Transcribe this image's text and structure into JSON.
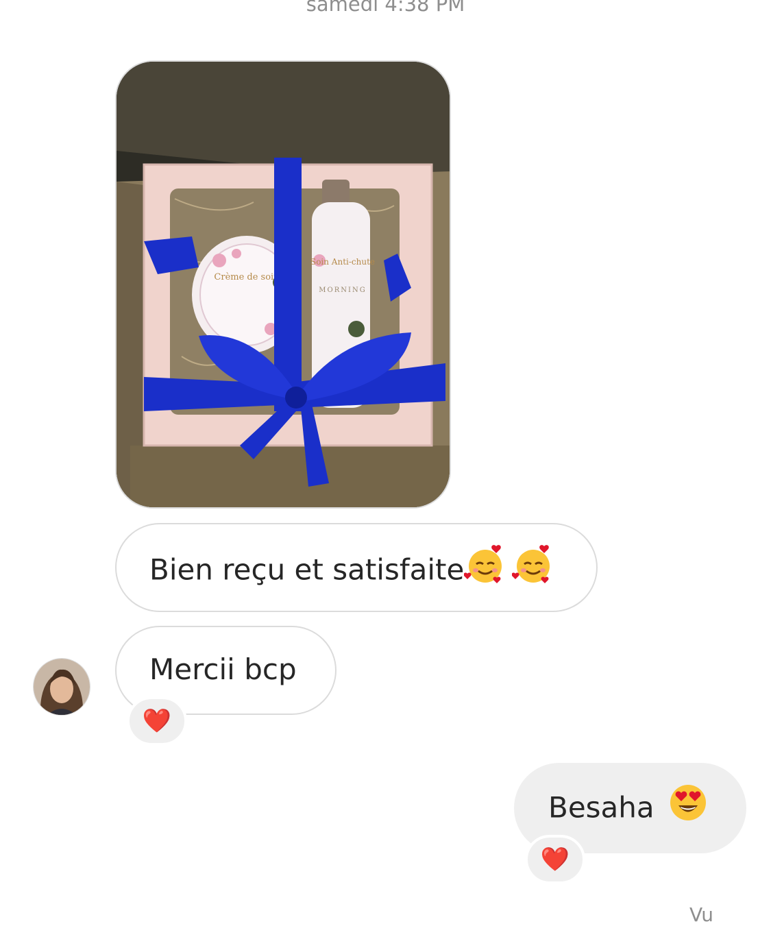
{
  "conversation": {
    "timestamp": "samedi 4:38 PM",
    "seen_label": "Vu"
  },
  "messages": [
    {
      "id": "m0",
      "type": "image",
      "sender": "contact"
    },
    {
      "id": "m1",
      "type": "text",
      "sender": "contact",
      "text": "Bien reçu et satisfaite",
      "emojis": [
        "smiling-face-with-hearts",
        "smiling-face-with-hearts"
      ]
    },
    {
      "id": "m2",
      "type": "text",
      "sender": "contact",
      "text": "Mercii bcp",
      "reaction": "❤️"
    },
    {
      "id": "m3",
      "type": "text",
      "sender": "me",
      "text": "Besaha",
      "emojis": [
        "heart-eyes"
      ],
      "reaction": "❤️"
    }
  ],
  "photo_labels": {
    "jar_label": "Crème de soin",
    "bottle_label": "Soin Anti-chute",
    "brand": "MORNING"
  },
  "colors": {
    "bubble_incoming_border": "#dbdbdb",
    "bubble_outgoing_bg": "#efefef",
    "timestamp": "#8e8e8e",
    "ribbon": "#1a2fc9"
  }
}
